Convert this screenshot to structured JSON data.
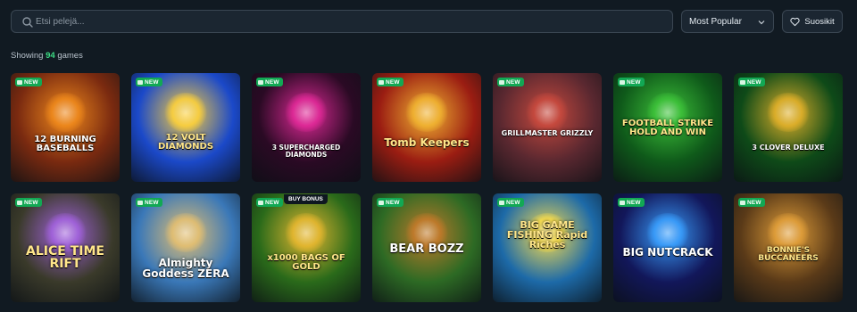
{
  "search": {
    "placeholder": "Etsi pelejä..."
  },
  "sort": {
    "selected": "Most Popular"
  },
  "favorites": {
    "label": "Suosikit"
  },
  "summary": {
    "prefix": "Showing",
    "count": "94",
    "suffix": "games"
  },
  "badge_new": "NEW",
  "games": [
    {
      "title": "12 BURNING BASEBALLS",
      "bg": "#7a2a10",
      "accent": "#f08a1c",
      "new": true
    },
    {
      "title": "12 VOLT DIAMONDS",
      "bg": "#1b49c9",
      "accent": "#ffd23a",
      "new": true
    },
    {
      "title": "3 SUPERCHARGED DIAMONDS",
      "bg": "#2a0a24",
      "accent": "#e42a9a",
      "new": true
    },
    {
      "title": "Tomb Keepers",
      "bg": "#9b1d12",
      "accent": "#f2b632",
      "new": true
    },
    {
      "title": "GRILLMASTER GRIZZLY",
      "bg": "#5a2830",
      "accent": "#c94a3e",
      "new": true
    },
    {
      "title": "FOOTBALL STRIKE HOLD AND WIN",
      "bg": "#0f5a1a",
      "accent": "#3ec43a",
      "new": true
    },
    {
      "title": "3 CLOVER DELUXE",
      "bg": "#0e4a18",
      "accent": "#e3b12a",
      "new": true
    },
    {
      "title": "ALICE TIME RIFT",
      "bg": "#3a3a2a",
      "accent": "#a463e0",
      "new": true
    },
    {
      "title": "Almighty Goddess ZERA",
      "bg": "#3a78b8",
      "accent": "#e6c070",
      "new": true
    },
    {
      "title": "x1000 BAGS OF GOLD",
      "bg": "#2a6a1a",
      "accent": "#e8b830",
      "new": true,
      "buy_bonus": "BUY BONUS"
    },
    {
      "title": "BEAR BOZZ",
      "bg": "#2d6a24",
      "accent": "#c47a2a",
      "new": true
    },
    {
      "title": "BIG GAME FISHING Rapid Riches",
      "bg": "#1d6aa8",
      "accent": "#ffe04a",
      "new": true
    },
    {
      "title": "BIG NUTCRACK",
      "bg": "#12175a",
      "accent": "#3aa0ff",
      "new": true
    },
    {
      "title": "BONNIE'S BUCCANEERS",
      "bg": "#5a3a18",
      "accent": "#e3a03a",
      "new": true
    }
  ]
}
